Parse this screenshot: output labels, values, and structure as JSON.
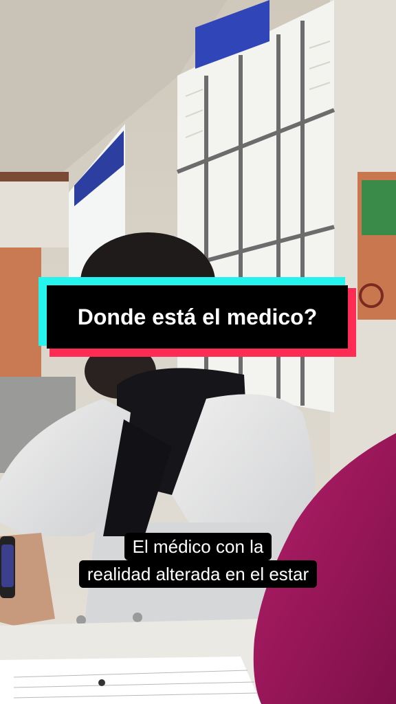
{
  "title": "Donde está el medico?",
  "caption": {
    "line1": "El médico con la",
    "line2": "realidad alterada en el estar"
  },
  "colors": {
    "title_bg": "#000000",
    "accent_cyan": "#25f4ee",
    "accent_red": "#fe2c55"
  }
}
